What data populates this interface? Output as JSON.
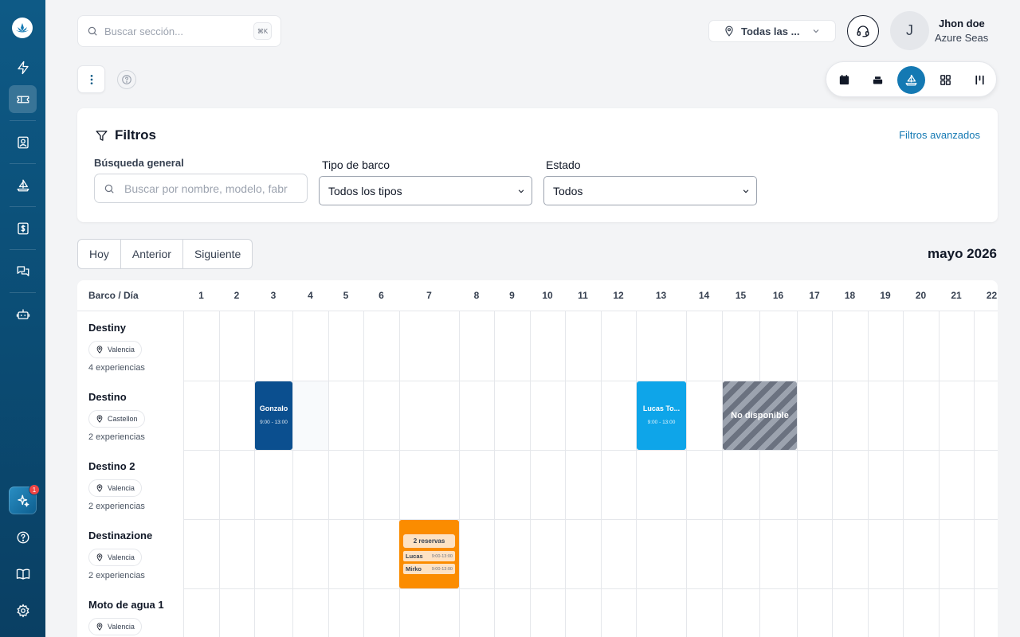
{
  "search": {
    "placeholder": "Buscar sección...",
    "shortcut": "⌘K"
  },
  "location_selector": {
    "value": "Todas las ..."
  },
  "user": {
    "initial": "J",
    "name": "Jhon doe",
    "org": "Azure Seas"
  },
  "sidebar": {
    "items": [
      {
        "name": "dashboard",
        "icon": "lightning-icon"
      },
      {
        "name": "bookings",
        "icon": "ticket-icon",
        "active": true
      },
      {
        "name": "clients",
        "icon": "contact-icon"
      },
      {
        "name": "boats",
        "icon": "sailboat-icon"
      },
      {
        "name": "payments",
        "icon": "dollar-icon"
      },
      {
        "name": "messages",
        "icon": "chat-icon"
      },
      {
        "name": "integrations",
        "icon": "bot-icon"
      }
    ],
    "ai_badge": "1",
    "bottom": [
      {
        "name": "help",
        "icon": "help-circle-icon"
      },
      {
        "name": "docs",
        "icon": "book-icon"
      },
      {
        "name": "settings",
        "icon": "gear-icon"
      }
    ]
  },
  "filters": {
    "title": "Filtros",
    "advanced": "Filtros avanzados",
    "general_label": "Búsqueda general",
    "general_placeholder": "Buscar por nombre, modelo, fabr",
    "boat_type_label": "Tipo de barco",
    "boat_type_value": "Todos los tipos",
    "status_label": "Estado",
    "status_value": "Todos"
  },
  "calendar_nav": {
    "today": "Hoy",
    "prev": "Anterior",
    "next": "Siguiente",
    "month": "mayo 2026"
  },
  "calendar": {
    "header_label": "Barco / Día",
    "days": [
      "1",
      "2",
      "3",
      "4",
      "5",
      "6",
      "7",
      "8",
      "9",
      "10",
      "11",
      "12",
      "13",
      "14",
      "15",
      "16",
      "17",
      "18",
      "19",
      "20",
      "21",
      "22"
    ],
    "rows": [
      {
        "name": "Destiny",
        "location": "Valencia",
        "experiences": "4 experiencias"
      },
      {
        "name": "Destino",
        "location": "Castellon",
        "experiences": "2 experiencias"
      },
      {
        "name": "Destino 2",
        "location": "Valencia",
        "experiences": "2 experiencias"
      },
      {
        "name": "Destinazione",
        "location": "Valencia",
        "experiences": "2 experiencias"
      },
      {
        "name": "Moto de agua 1",
        "location": "Valencia",
        "experiences": ""
      }
    ],
    "events": {
      "gonzalo": {
        "name": "Gonzalo",
        "time": "9:00 - 13:00",
        "color": "#0b4f8f"
      },
      "lucas": {
        "name": "Lucas To...",
        "time": "9:00 - 13:00",
        "color": "#0ea5e9"
      },
      "unavailable": {
        "label": "No disponible"
      },
      "multi": {
        "header": "2 reservas",
        "items": [
          {
            "name": "Lucas",
            "time": "9:00-13:00"
          },
          {
            "name": "Mirko",
            "time": "9:00-13:00"
          }
        ],
        "color": "#fb8c00"
      }
    }
  }
}
